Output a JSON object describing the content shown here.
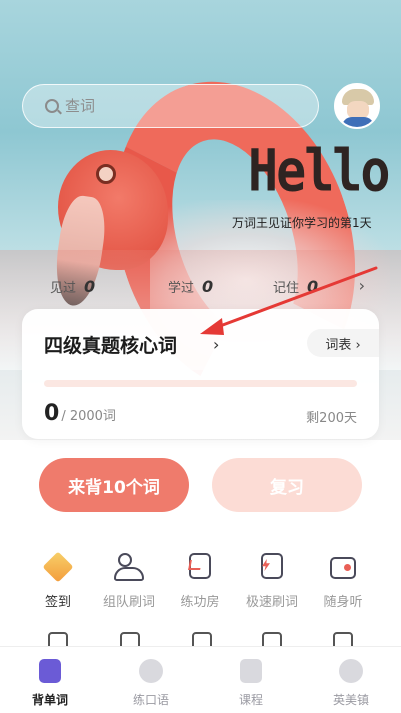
{
  "search": {
    "placeholder": "查词"
  },
  "hero": {
    "greeting": "Hello",
    "subtitle": "万词王见证你学习的第1天"
  },
  "stats": [
    {
      "label": "见过",
      "value": "0"
    },
    {
      "label": "学过",
      "value": "0"
    },
    {
      "label": "记住",
      "value": "0"
    }
  ],
  "book": {
    "title": "四级真题核心词",
    "wordlist_label": "词表 ›",
    "learned": "0",
    "total": "/ 2000词",
    "remaining": "剩200天",
    "progress": 0
  },
  "actions": {
    "learn": "来背10个词",
    "review": "复习"
  },
  "features": [
    {
      "label": "签到",
      "icon": "diamond-icon"
    },
    {
      "label": "组队刷词",
      "icon": "team-icon"
    },
    {
      "label": "练功房",
      "icon": "practice-room-icon"
    },
    {
      "label": "极速刷词",
      "icon": "speed-icon"
    },
    {
      "label": "随身听",
      "icon": "radio-icon"
    }
  ],
  "tabs": [
    {
      "label": "背单词",
      "icon": "book-icon",
      "active": true
    },
    {
      "label": "练口语",
      "icon": "play-icon",
      "active": false
    },
    {
      "label": "课程",
      "icon": "bookmark-icon",
      "active": false
    },
    {
      "label": "英美镇",
      "icon": "compass-icon",
      "active": false
    }
  ],
  "colors": {
    "accent": "#ef7b6c",
    "tab_active": "#6b5bd6",
    "arrow": "#e53935"
  }
}
